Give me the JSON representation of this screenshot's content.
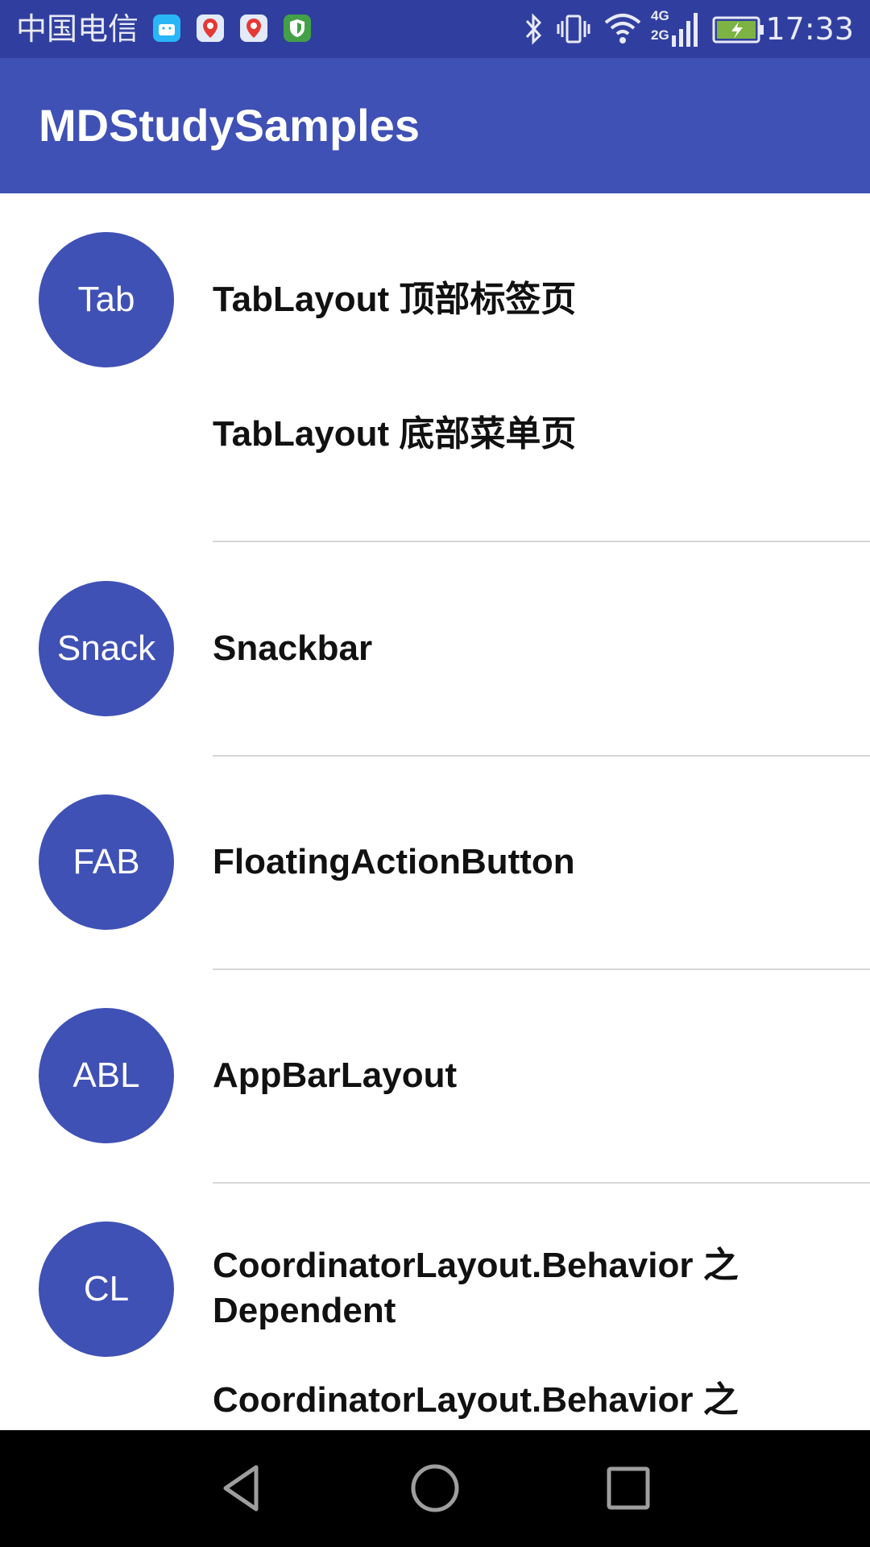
{
  "status_bar": {
    "carrier": "中国电信",
    "time": "17:33",
    "network_label_top": "4G",
    "network_label_bottom": "2G",
    "app_icons": [
      "android-app-icon",
      "du-map-icon",
      "du-map-icon",
      "shield-app-icon"
    ],
    "icons": [
      "bluetooth-icon",
      "vibrate-icon",
      "wifi-icon",
      "signal-icon",
      "battery-charging-icon"
    ]
  },
  "app_bar": {
    "title": "MDStudySamples",
    "color": "#3f51b5"
  },
  "list": {
    "groups": [
      {
        "avatar": "Tab",
        "items": [
          "TabLayout 顶部标签页",
          "TabLayout 底部菜单页"
        ]
      },
      {
        "avatar": "Snack",
        "items": [
          "Snackbar"
        ]
      },
      {
        "avatar": "FAB",
        "items": [
          "FloatingActionButton"
        ]
      },
      {
        "avatar": "ABL",
        "items": [
          "AppBarLayout"
        ]
      },
      {
        "avatar": "CL",
        "items": [
          "CoordinatorLayout.Behavior 之 Dependent",
          "CoordinatorLayout.Behavior 之"
        ]
      }
    ]
  },
  "nav_bar": {
    "buttons": [
      "back-icon",
      "home-icon",
      "recents-icon"
    ]
  },
  "colors": {
    "status_bar": "#303f9f",
    "primary": "#3f51b5",
    "nav_bar": "#000000"
  }
}
